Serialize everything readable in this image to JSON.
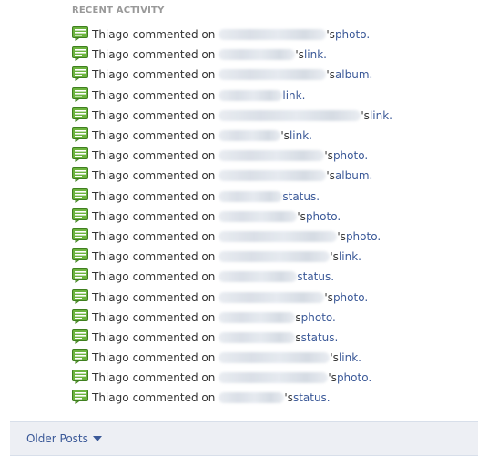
{
  "section": {
    "title": "RECENT ACTIVITY"
  },
  "activity": [
    {
      "actor": "Thiago",
      "verb": "commented on",
      "possessive": "'s",
      "target": "photo."
    },
    {
      "actor": "Thiago",
      "verb": "commented on",
      "possessive": "'s",
      "target": "link."
    },
    {
      "actor": "Thiago",
      "verb": "commented on",
      "possessive": "'s",
      "target": "album."
    },
    {
      "actor": "Thiago",
      "verb": "commented on",
      "possessive": "",
      "target": "link."
    },
    {
      "actor": "Thiago",
      "verb": "commented on",
      "possessive": "'s",
      "target": "link."
    },
    {
      "actor": "Thiago",
      "verb": "commented on",
      "possessive": "'s",
      "target": "link."
    },
    {
      "actor": "Thiago",
      "verb": "commented on",
      "possessive": "'s",
      "target": "photo."
    },
    {
      "actor": "Thiago",
      "verb": "commented on",
      "possessive": "'s",
      "target": "album."
    },
    {
      "actor": "Thiago",
      "verb": "commented on",
      "possessive": "",
      "target": "status."
    },
    {
      "actor": "Thiago",
      "verb": "commented on",
      "possessive": "'s",
      "target": "photo."
    },
    {
      "actor": "Thiago",
      "verb": "commented on",
      "possessive": "'s",
      "target": "photo."
    },
    {
      "actor": "Thiago",
      "verb": "commented on",
      "possessive": "'s",
      "target": "link."
    },
    {
      "actor": "Thiago",
      "verb": "commented on",
      "possessive": "",
      "target": "status."
    },
    {
      "actor": "Thiago",
      "verb": "commented on",
      "possessive": "'s",
      "target": "photo."
    },
    {
      "actor": "Thiago",
      "verb": "commented on",
      "possessive": "s",
      "target": "photo."
    },
    {
      "actor": "Thiago",
      "verb": "commented on",
      "possessive": "s",
      "target": "status."
    },
    {
      "actor": "Thiago",
      "verb": "commented on",
      "possessive": "'s",
      "target": "link."
    },
    {
      "actor": "Thiago",
      "verb": "commented on",
      "possessive": "'s",
      "target": "photo."
    },
    {
      "actor": "Thiago",
      "verb": "commented on",
      "possessive": "'s",
      "target": "status."
    }
  ],
  "footer": {
    "older_posts_label": "Older Posts"
  },
  "colors": {
    "link": "#3b5998",
    "icon_green": "#5ba529",
    "footer_bg": "#edeff4"
  },
  "icons": {
    "comment": "comment-bubble-icon",
    "caret": "caret-down-icon"
  }
}
